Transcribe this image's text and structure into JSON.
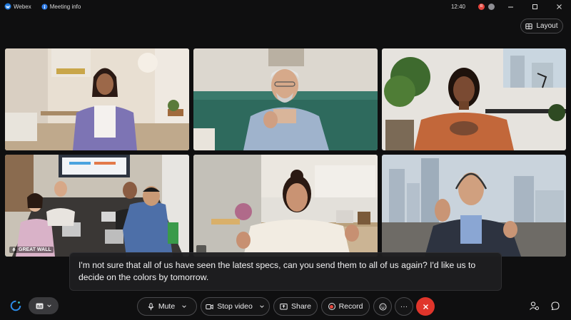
{
  "titlebar": {
    "app_name": "Webex",
    "meeting_info": "Meeting info",
    "clock": "12:40",
    "avatar_initial": "R"
  },
  "layout_button": {
    "label": "Layout"
  },
  "tiles": [
    {
      "id": "participant-1"
    },
    {
      "id": "participant-2"
    },
    {
      "id": "participant-3"
    },
    {
      "id": "participant-4",
      "label": "GREAT WALL",
      "active_speaker": true
    },
    {
      "id": "participant-5"
    },
    {
      "id": "participant-6"
    }
  ],
  "caption": {
    "text": "I'm not sure that all of us have seen the latest specs, can you send them to all of us again? I'd like us to decide on the colors by tomorrow."
  },
  "controls": {
    "mute": "Mute",
    "stop_video": "Stop video",
    "share": "Share",
    "record": "Record",
    "more": "···"
  },
  "colors": {
    "accent_active": "#35c0c6",
    "end_call": "#e0352b",
    "record_dot": "#e8473d"
  },
  "icons": [
    "webex-icon",
    "meeting-info-icon",
    "layout-icon",
    "mic-icon",
    "video-icon",
    "share-icon",
    "record-icon",
    "reactions-icon",
    "more-icon",
    "end-call-icon",
    "ai-assistant-icon",
    "closed-captions-icon",
    "participants-icon",
    "chat-icon"
  ]
}
